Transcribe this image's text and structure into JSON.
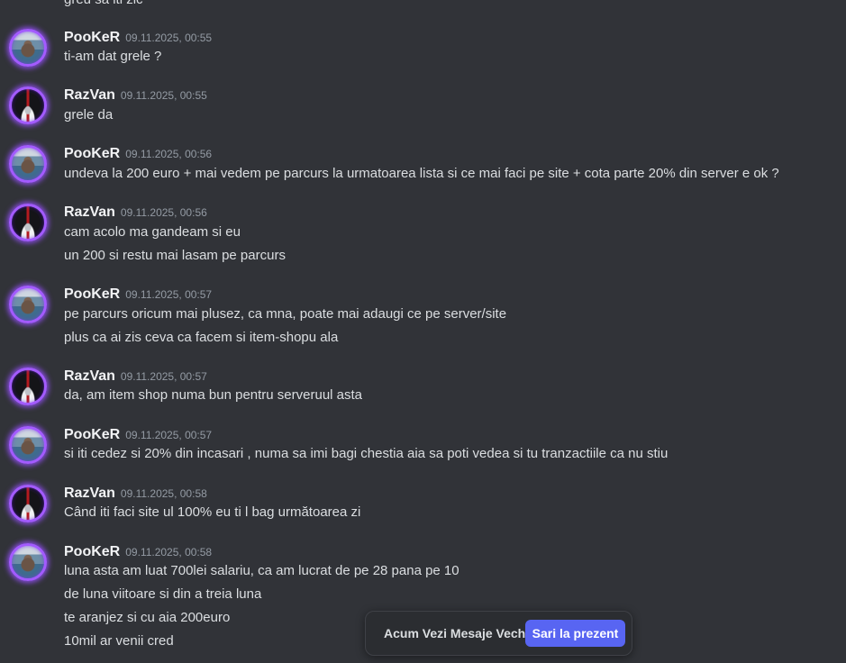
{
  "partial_top_text": "greu sa iti zic",
  "messages": [
    {
      "author": "PooKeR",
      "avatar": "pooker-avatar",
      "time": "09.11.2025, 00:55",
      "lines": [
        "ti-am dat grele ?"
      ]
    },
    {
      "author": "RazVan",
      "avatar": "razvan-avatar",
      "time": "09.11.2025, 00:55",
      "lines": [
        "grele da"
      ]
    },
    {
      "author": "PooKeR",
      "avatar": "pooker-avatar",
      "time": "09.11.2025, 00:56",
      "lines": [
        "undeva la 200 euro + mai vedem pe parcurs la urmatoarea lista  si ce mai faci pe site + cota parte 20% din server e ok ?"
      ]
    },
    {
      "author": "RazVan",
      "avatar": "razvan-avatar",
      "time": "09.11.2025, 00:56",
      "lines": [
        "cam acolo ma gandeam si eu",
        "un 200 si restu mai lasam pe parcurs"
      ]
    },
    {
      "author": "PooKeR",
      "avatar": "pooker-avatar",
      "time": "09.11.2025, 00:57",
      "lines": [
        "pe parcurs oricum mai plusez, ca mna, poate mai adaugi ce pe server/site",
        "plus ca ai zis ceva ca facem si item-shopu ala"
      ]
    },
    {
      "author": "RazVan",
      "avatar": "razvan-avatar",
      "time": "09.11.2025, 00:57",
      "lines": [
        "da, am item shop numa bun pentru serveruul asta"
      ]
    },
    {
      "author": "PooKeR",
      "avatar": "pooker-avatar",
      "time": "09.11.2025, 00:57",
      "lines": [
        "si iti cedez si 20% din incasari , numa sa imi bagi chestia aia sa poti vedea si tu tranzactiile ca nu stiu"
      ]
    },
    {
      "author": "RazVan",
      "avatar": "razvan-avatar",
      "time": "09.11.2025, 00:58",
      "lines": [
        "Când iti faci site ul 100% eu ti l bag următoarea zi"
      ]
    },
    {
      "author": "PooKeR",
      "avatar": "pooker-avatar",
      "time": "09.11.2025, 00:58",
      "lines": [
        "luna asta am luat 700lei salariu, ca am lucrat de pe 28 pana pe 10",
        "de luna viitoare si din a treia luna",
        "te aranjez si cu aia 200euro",
        "10mil ar venii cred"
      ]
    }
  ],
  "jump_bar": {
    "label": "Acum Vezi Mesaje Vechi",
    "button": "Sari la prezent"
  }
}
